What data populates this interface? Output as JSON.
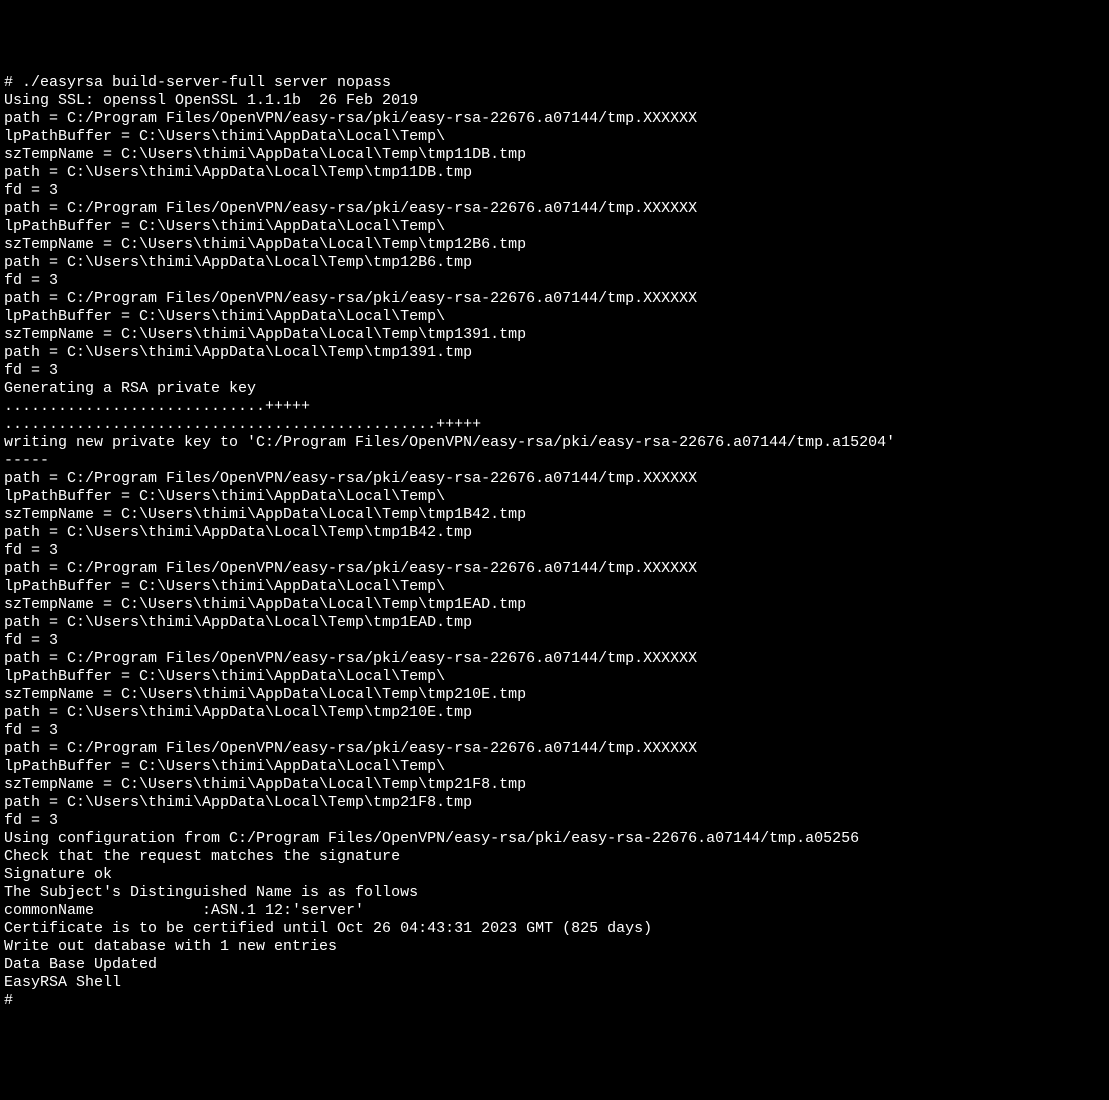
{
  "terminal": {
    "lines": [
      "# ./easyrsa build-server-full server nopass",
      "Using SSL: openssl OpenSSL 1.1.1b  26 Feb 2019",
      "path = C:/Program Files/OpenVPN/easy-rsa/pki/easy-rsa-22676.a07144/tmp.XXXXXX",
      "lpPathBuffer = C:\\Users\\thimi\\AppData\\Local\\Temp\\",
      "szTempName = C:\\Users\\thimi\\AppData\\Local\\Temp\\tmp11DB.tmp",
      "path = C:\\Users\\thimi\\AppData\\Local\\Temp\\tmp11DB.tmp",
      "fd = 3",
      "path = C:/Program Files/OpenVPN/easy-rsa/pki/easy-rsa-22676.a07144/tmp.XXXXXX",
      "lpPathBuffer = C:\\Users\\thimi\\AppData\\Local\\Temp\\",
      "szTempName = C:\\Users\\thimi\\AppData\\Local\\Temp\\tmp12B6.tmp",
      "path = C:\\Users\\thimi\\AppData\\Local\\Temp\\tmp12B6.tmp",
      "fd = 3",
      "path = C:/Program Files/OpenVPN/easy-rsa/pki/easy-rsa-22676.a07144/tmp.XXXXXX",
      "lpPathBuffer = C:\\Users\\thimi\\AppData\\Local\\Temp\\",
      "szTempName = C:\\Users\\thimi\\AppData\\Local\\Temp\\tmp1391.tmp",
      "path = C:\\Users\\thimi\\AppData\\Local\\Temp\\tmp1391.tmp",
      "fd = 3",
      "Generating a RSA private key",
      ".............................+++++",
      "................................................+++++",
      "writing new private key to 'C:/Program Files/OpenVPN/easy-rsa/pki/easy-rsa-22676.a07144/tmp.a15204'",
      "-----",
      "path = C:/Program Files/OpenVPN/easy-rsa/pki/easy-rsa-22676.a07144/tmp.XXXXXX",
      "lpPathBuffer = C:\\Users\\thimi\\AppData\\Local\\Temp\\",
      "szTempName = C:\\Users\\thimi\\AppData\\Local\\Temp\\tmp1B42.tmp",
      "path = C:\\Users\\thimi\\AppData\\Local\\Temp\\tmp1B42.tmp",
      "fd = 3",
      "path = C:/Program Files/OpenVPN/easy-rsa/pki/easy-rsa-22676.a07144/tmp.XXXXXX",
      "lpPathBuffer = C:\\Users\\thimi\\AppData\\Local\\Temp\\",
      "szTempName = C:\\Users\\thimi\\AppData\\Local\\Temp\\tmp1EAD.tmp",
      "path = C:\\Users\\thimi\\AppData\\Local\\Temp\\tmp1EAD.tmp",
      "fd = 3",
      "path = C:/Program Files/OpenVPN/easy-rsa/pki/easy-rsa-22676.a07144/tmp.XXXXXX",
      "lpPathBuffer = C:\\Users\\thimi\\AppData\\Local\\Temp\\",
      "szTempName = C:\\Users\\thimi\\AppData\\Local\\Temp\\tmp210E.tmp",
      "path = C:\\Users\\thimi\\AppData\\Local\\Temp\\tmp210E.tmp",
      "fd = 3",
      "path = C:/Program Files/OpenVPN/easy-rsa/pki/easy-rsa-22676.a07144/tmp.XXXXXX",
      "lpPathBuffer = C:\\Users\\thimi\\AppData\\Local\\Temp\\",
      "szTempName = C:\\Users\\thimi\\AppData\\Local\\Temp\\tmp21F8.tmp",
      "path = C:\\Users\\thimi\\AppData\\Local\\Temp\\tmp21F8.tmp",
      "fd = 3",
      "Using configuration from C:/Program Files/OpenVPN/easy-rsa/pki/easy-rsa-22676.a07144/tmp.a05256",
      "Check that the request matches the signature",
      "Signature ok",
      "The Subject's Distinguished Name is as follows",
      "commonName            :ASN.1 12:'server'",
      "Certificate is to be certified until Oct 26 04:43:31 2023 GMT (825 days)",
      "",
      "Write out database with 1 new entries",
      "Data Base Updated",
      "",
      "",
      "EasyRSA Shell",
      "# "
    ]
  }
}
